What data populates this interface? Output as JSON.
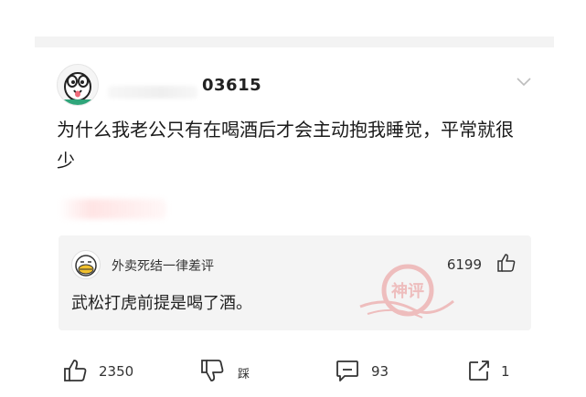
{
  "post": {
    "username": "03615",
    "text": "为什么我老公只有在喝酒后才会主动抱我睡觉，平常就很少"
  },
  "top_comment": {
    "author": "外卖死结一律差评",
    "likes": "6199",
    "text": "武松打虎前提是喝了酒。",
    "stamp_text": "神评"
  },
  "actions": {
    "like_count": "2350",
    "dislike_label": "踩",
    "comment_count": "93",
    "share_count": "1"
  },
  "icons": {
    "menu": "chevron-down-icon",
    "like": "thumbs-up-icon",
    "dislike": "thumbs-down-icon",
    "comment": "comment-bubble-icon",
    "share": "share-icon"
  },
  "colors": {
    "comment_bg": "#f4f4f4",
    "stamp": "#e35a5a"
  }
}
